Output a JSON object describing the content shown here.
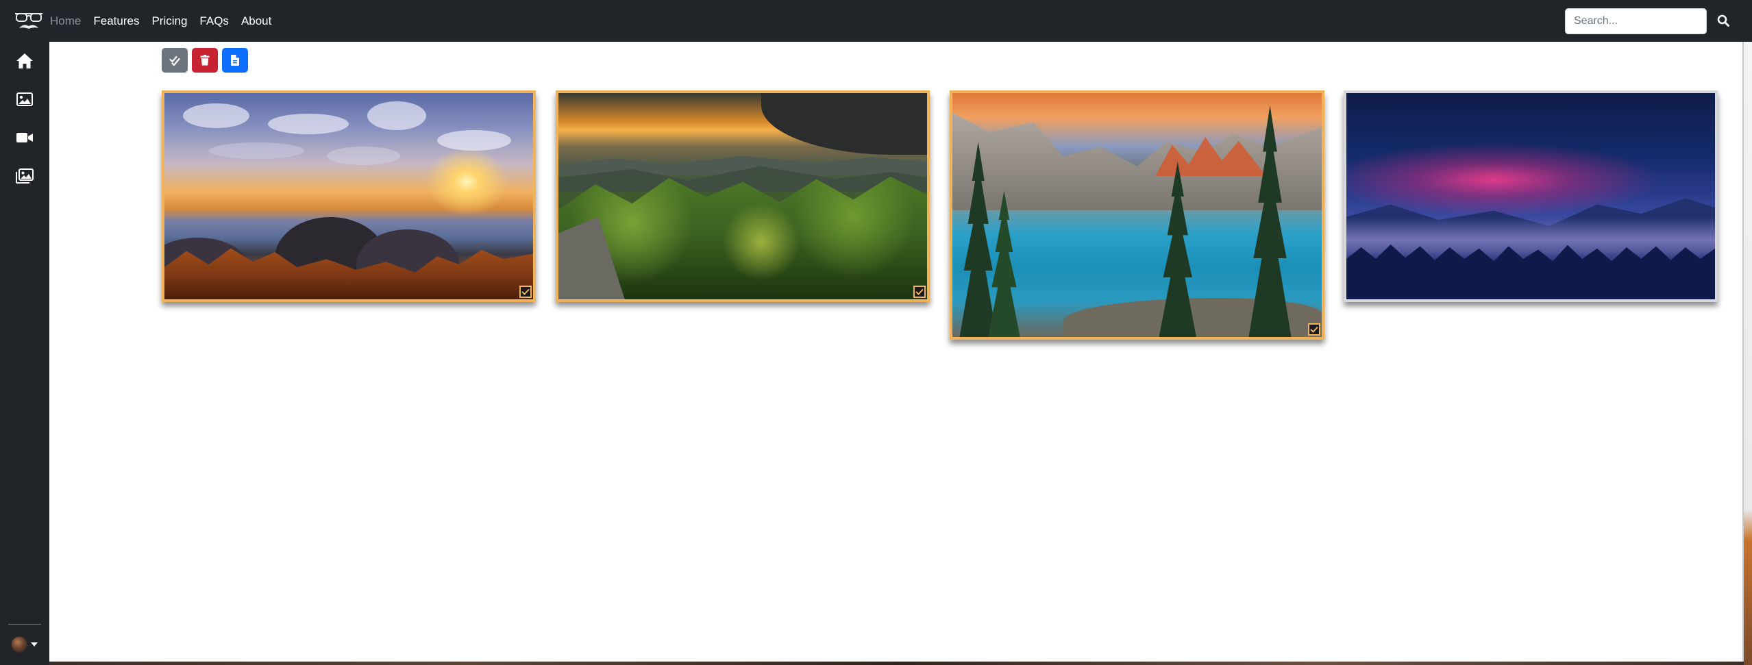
{
  "navbar": {
    "brand_icon": "glasses-mustache-logo-icon",
    "links": [
      {
        "label": "Home",
        "active": true
      },
      {
        "label": "Features",
        "active": false
      },
      {
        "label": "Pricing",
        "active": false
      },
      {
        "label": "FAQs",
        "active": false
      },
      {
        "label": "About",
        "active": false
      }
    ],
    "search": {
      "placeholder": "Search...",
      "value": ""
    },
    "search_icon": "search-icon"
  },
  "sidebar": {
    "items": [
      {
        "name": "home",
        "icon": "home-icon"
      },
      {
        "name": "images",
        "icon": "image-icon"
      },
      {
        "name": "videos",
        "icon": "video-camera-icon"
      },
      {
        "name": "albums",
        "icon": "images-stack-icon"
      }
    ],
    "account_icon": "avatar"
  },
  "toolbar": {
    "buttons": [
      {
        "name": "select-all",
        "icon": "check-double-icon",
        "color": "#6c757d"
      },
      {
        "name": "delete",
        "icon": "trash-icon",
        "color": "#c82333"
      },
      {
        "name": "export",
        "icon": "file-icon",
        "color": "#0d6efd"
      }
    ]
  },
  "gallery": {
    "selection_color": "#f0b35a",
    "items": [
      {
        "subject": "sunset-over-misty-hills",
        "selected": true
      },
      {
        "subject": "green-forest-at-sunset",
        "selected": true
      },
      {
        "subject": "mountain-lake-with-pines",
        "selected": true
      },
      {
        "subject": "purple-dusk-mountains",
        "selected": false
      }
    ]
  }
}
